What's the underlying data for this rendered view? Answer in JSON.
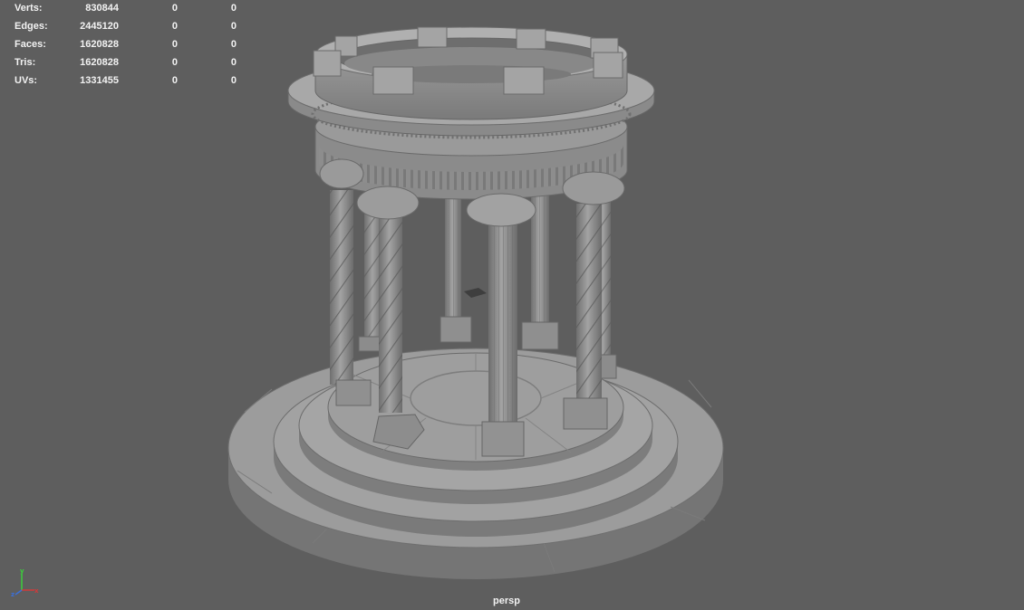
{
  "viewport": {
    "camera": "persp",
    "background": "#5e5e5e",
    "model_color": "#8f8f8f"
  },
  "hud": {
    "rows": [
      {
        "label": "Verts:",
        "v1": "830844",
        "v2": "0",
        "v3": "0"
      },
      {
        "label": "Edges:",
        "v1": "2445120",
        "v2": "0",
        "v3": "0"
      },
      {
        "label": "Faces:",
        "v1": "1620828",
        "v2": "0",
        "v3": "0"
      },
      {
        "label": "Tris:",
        "v1": "1620828",
        "v2": "0",
        "v3": "0"
      },
      {
        "label": "UVs:",
        "v1": "1331455",
        "v2": "0",
        "v3": "0"
      }
    ]
  },
  "axis": {
    "x": {
      "label": "x",
      "color": "#d23a3a"
    },
    "y": {
      "label": "y",
      "color": "#3ccf3c"
    },
    "z": {
      "label": "z",
      "color": "#3b6fd6"
    }
  }
}
